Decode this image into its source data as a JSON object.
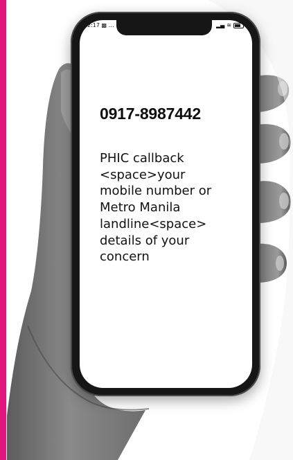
{
  "status_bar": {
    "time": "2:17",
    "indicators": "…"
  },
  "message": {
    "hotline": "0917-8987442",
    "lines": [
      "PHIC callback",
      "<space>your",
      "mobile number or",
      "Metro Manila",
      "landline<space>",
      "details of your",
      "concern"
    ]
  },
  "colors": {
    "accent": "#e0147f",
    "phone_frame": "#161616",
    "screen": "#ffffff",
    "text": "#111111"
  }
}
